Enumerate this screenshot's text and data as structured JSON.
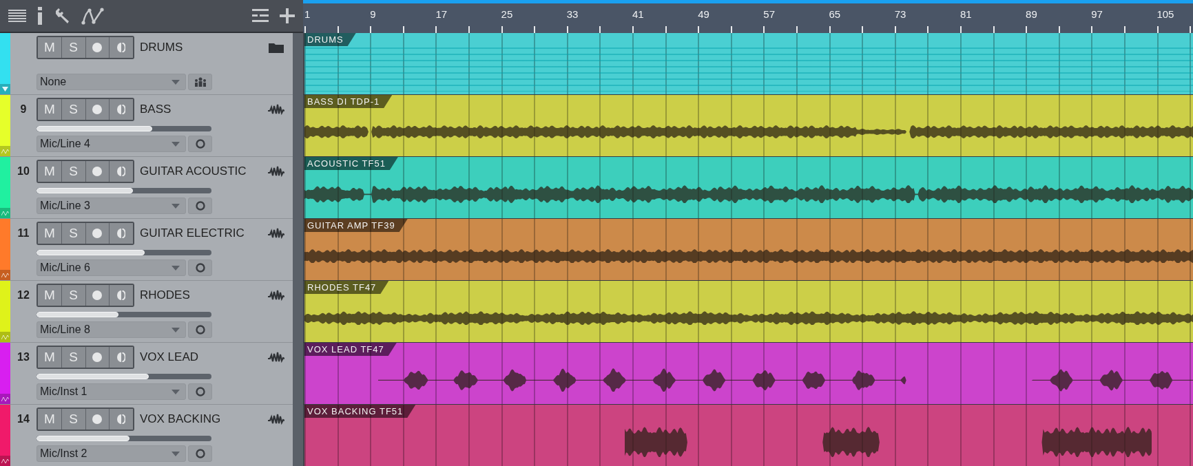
{
  "ruler": {
    "bars": [
      "1",
      "9",
      "17",
      "25",
      "33",
      "41",
      "49",
      "57",
      "65",
      "73",
      "81",
      "89",
      "97",
      "105"
    ]
  },
  "tracks": [
    {
      "kind": "folder",
      "name": "DRUMS",
      "color": "#33e0f0",
      "mute": "M",
      "solo": "S",
      "input": "None",
      "clip": {
        "label": "DRUMS",
        "color": "#4acfd2"
      }
    },
    {
      "kind": "audio",
      "number": "9",
      "name": "BASS",
      "color": "#e6ff2a",
      "mute": "M",
      "solo": "S",
      "level": 0.66,
      "input": "Mic/Line 4",
      "clip": {
        "label": "BASS DI TDP-1",
        "color": "#cccf48"
      }
    },
    {
      "kind": "audio",
      "number": "10",
      "name": "GUITAR ACOUSTIC",
      "color": "#20f0a0",
      "mute": "M",
      "solo": "S",
      "level": 0.55,
      "input": "Mic/Line 3",
      "clip": {
        "label": "ACOUSTIC TF51",
        "color": "#3dcfbc"
      }
    },
    {
      "kind": "audio",
      "number": "11",
      "name": "GUITAR ELECTRIC",
      "color": "#ff7a2a",
      "mute": "M",
      "solo": "S",
      "level": 0.62,
      "input": "Mic/Line 6",
      "clip": {
        "label": "GUITAR AMP TF39",
        "color": "#cc8a4a"
      }
    },
    {
      "kind": "audio",
      "number": "12",
      "name": "RHODES",
      "color": "#dff21a",
      "mute": "M",
      "solo": "S",
      "level": 0.47,
      "input": "Mic/Line 8",
      "clip": {
        "label": "RHODES TF47",
        "color": "#cccf48"
      }
    },
    {
      "kind": "audio",
      "number": "13",
      "name": "VOX LEAD",
      "color": "#d81ff0",
      "mute": "M",
      "solo": "S",
      "level": 0.64,
      "input": "Mic/Inst 1",
      "clip": {
        "label": "VOX LEAD TF47",
        "color": "#cc44cc"
      }
    },
    {
      "kind": "audio",
      "number": "14",
      "name": "VOX BACKING",
      "color": "#f01a6a",
      "mute": "M",
      "solo": "S",
      "level": 0.53,
      "input": "Mic/Inst 2",
      "clip": {
        "label": "VOX BACKING TF51",
        "color": "#cc4480"
      }
    }
  ]
}
